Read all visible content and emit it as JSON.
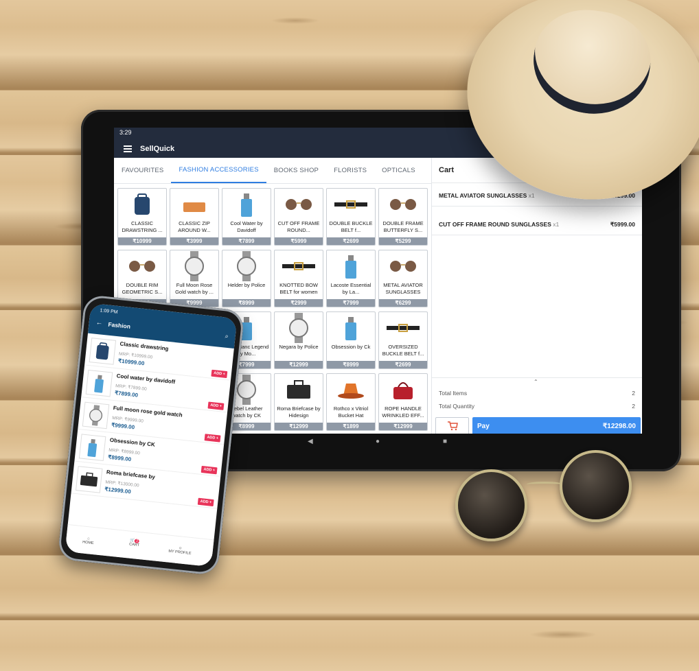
{
  "tablet": {
    "status_time": "3:29",
    "app_title": "SellQuick",
    "tabs": [
      "FAVOURITES",
      "FASHION ACCESSORIES",
      "BOOKS SHOP",
      "FLORISTS",
      "OPTICALS"
    ],
    "active_tab": "FASHION ACCESSORIES",
    "products": [
      {
        "name": "CLASSIC DRAWSTRING ...",
        "price": "₹10999",
        "icon": "backpack-icon"
      },
      {
        "name": "CLASSIC ZIP AROUND W...",
        "price": "₹3999",
        "icon": "wallet-icon"
      },
      {
        "name": "Cool Water by Davidoff",
        "price": "₹7899",
        "icon": "perfume-icon"
      },
      {
        "name": "CUT OFF FRAME ROUND...",
        "price": "₹5999",
        "icon": "sunglasses-icon"
      },
      {
        "name": "DOUBLE BUCKLE BELT f...",
        "price": "₹2699",
        "icon": "belt-icon"
      },
      {
        "name": "DOUBLE FRAME BUTTERFLY S...",
        "price": "₹5299",
        "icon": "sunglasses-icon"
      },
      {
        "name": "DOUBLE RIM GEOMETRIC S...",
        "price": "₹6299",
        "icon": "sunglasses-icon"
      },
      {
        "name": "Full Moon Rose Gold watch by ...",
        "price": "₹9999",
        "icon": "watch-icon"
      },
      {
        "name": "Helder by Police",
        "price": "₹8999",
        "icon": "watch-icon"
      },
      {
        "name": "KNOTTED BOW BELT for women",
        "price": "₹2999",
        "icon": "belt-icon"
      },
      {
        "name": "Lacoste Essential by La...",
        "price": "₹7999",
        "icon": "perfume-icon"
      },
      {
        "name": "METAL AVIATOR SUNGLASSES",
        "price": "₹6299",
        "icon": "sunglasses-icon"
      },
      {
        "name": "",
        "price": "",
        "icon": "hidden"
      },
      {
        "name": "",
        "price": "",
        "icon": "hidden"
      },
      {
        "name": "Mont Blanc Legend by Mo...",
        "price": "₹7999",
        "icon": "perfume-icon"
      },
      {
        "name": "Negara by Police",
        "price": "₹12999",
        "icon": "watch-icon"
      },
      {
        "name": "Obsession by Ck",
        "price": "₹8999",
        "icon": "perfume-icon"
      },
      {
        "name": "OVERSIZED BUCKLE BELT f...",
        "price": "₹2699",
        "icon": "belt-icon"
      },
      {
        "name": "",
        "price": "",
        "icon": "hidden"
      },
      {
        "name": "",
        "price": "",
        "icon": "hidden"
      },
      {
        "name": "Rebel Leather watch by CK",
        "price": "₹8999",
        "icon": "watch-icon"
      },
      {
        "name": "Roma Briefcase by Hidesign",
        "price": "₹12999",
        "icon": "briefcase-icon"
      },
      {
        "name": "Rothco x Vitriol Bucket Hat",
        "price": "₹1899",
        "icon": "hat-icon"
      },
      {
        "name": "ROPE HANDLE WRINKLED EFF...",
        "price": "₹12999",
        "icon": "handbag-icon"
      }
    ],
    "cart": {
      "title": "Cart",
      "items": [
        {
          "name": "METAL AVIATOR SUNGLASSES",
          "qty": "x1",
          "price": "₹6299.00"
        },
        {
          "name": "CUT OFF FRAME ROUND SUNGLASSES",
          "qty": "x1",
          "price": "₹5999.00"
        }
      ],
      "total_items_label": "Total Items",
      "total_items": "2",
      "total_quantity_label": "Total Quantity",
      "total_quantity": "2",
      "pay_label": "Pay",
      "pay_amount": "₹12298.00"
    }
  },
  "phone": {
    "status_time": "1:09 PM",
    "title": "Fashion",
    "items": [
      {
        "name": "Classic drawstring",
        "mrp": "MRP: ₹10999.00",
        "price": "₹10999.00",
        "add": "ADD +"
      },
      {
        "name": "Cool water by davidoff",
        "mrp": "MRP: ₹7899.00",
        "price": "₹7899.00",
        "add": "ADD +"
      },
      {
        "name": "Full moon rose gold watch",
        "mrp": "MRP: ₹9999.00",
        "price": "₹9999.00",
        "add": "ADD +"
      },
      {
        "name": "Obsession by CK",
        "mrp": "MRP: ₹8999.00",
        "price": "₹8999.00",
        "add": "ADD +"
      },
      {
        "name": "Roma briefcase by",
        "mrp": "MRP: ₹13000.00",
        "price": "₹12999.00",
        "add": "ADD +"
      }
    ],
    "nav": {
      "home": "HOME",
      "cart": "CART",
      "cart_badge": "2",
      "profile": "MY PROFILE"
    }
  }
}
